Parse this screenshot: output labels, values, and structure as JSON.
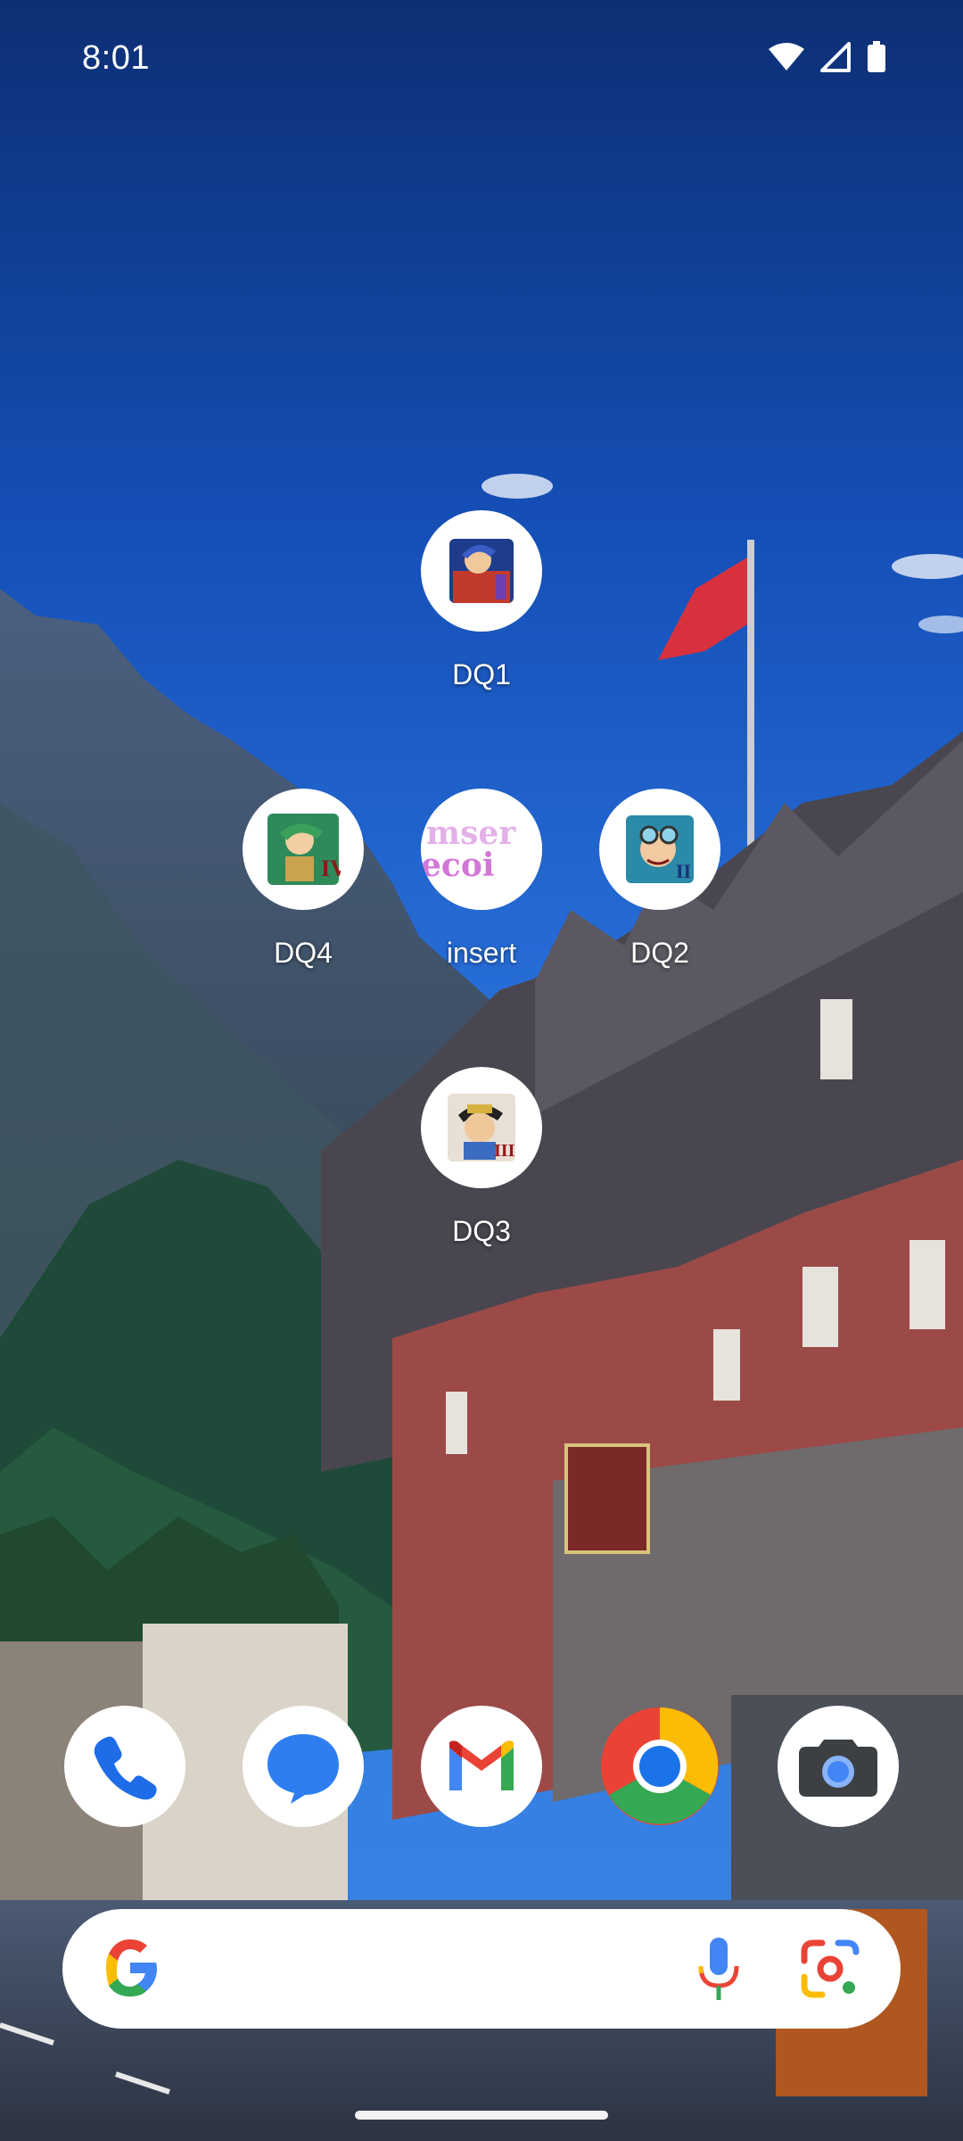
{
  "status_bar": {
    "time": "8:01",
    "icons": [
      "wifi-icon",
      "cell-signal-icon",
      "battery-icon"
    ]
  },
  "home_apps": [
    {
      "id": "dq1",
      "label": "DQ1"
    },
    {
      "id": "dq4",
      "label": "DQ4"
    },
    {
      "id": "insert",
      "label": "insert"
    },
    {
      "id": "dq2",
      "label": "DQ2"
    },
    {
      "id": "dq3",
      "label": "DQ3"
    }
  ],
  "dock": {
    "apps": [
      "phone-icon",
      "messages-icon",
      "gmail-icon",
      "chrome-icon",
      "camera-icon"
    ]
  },
  "search_bar": {
    "icons": [
      "google-g-icon",
      "mic-icon",
      "google-lens-icon"
    ]
  },
  "insert_icon_text": {
    "line1": "mser",
    "line2": "ecoi"
  },
  "colors": {
    "sky": "#1a59c6",
    "google_blue": "#4285F4",
    "google_red": "#EA4335",
    "google_yellow": "#FBBC05",
    "google_green": "#34A853"
  }
}
